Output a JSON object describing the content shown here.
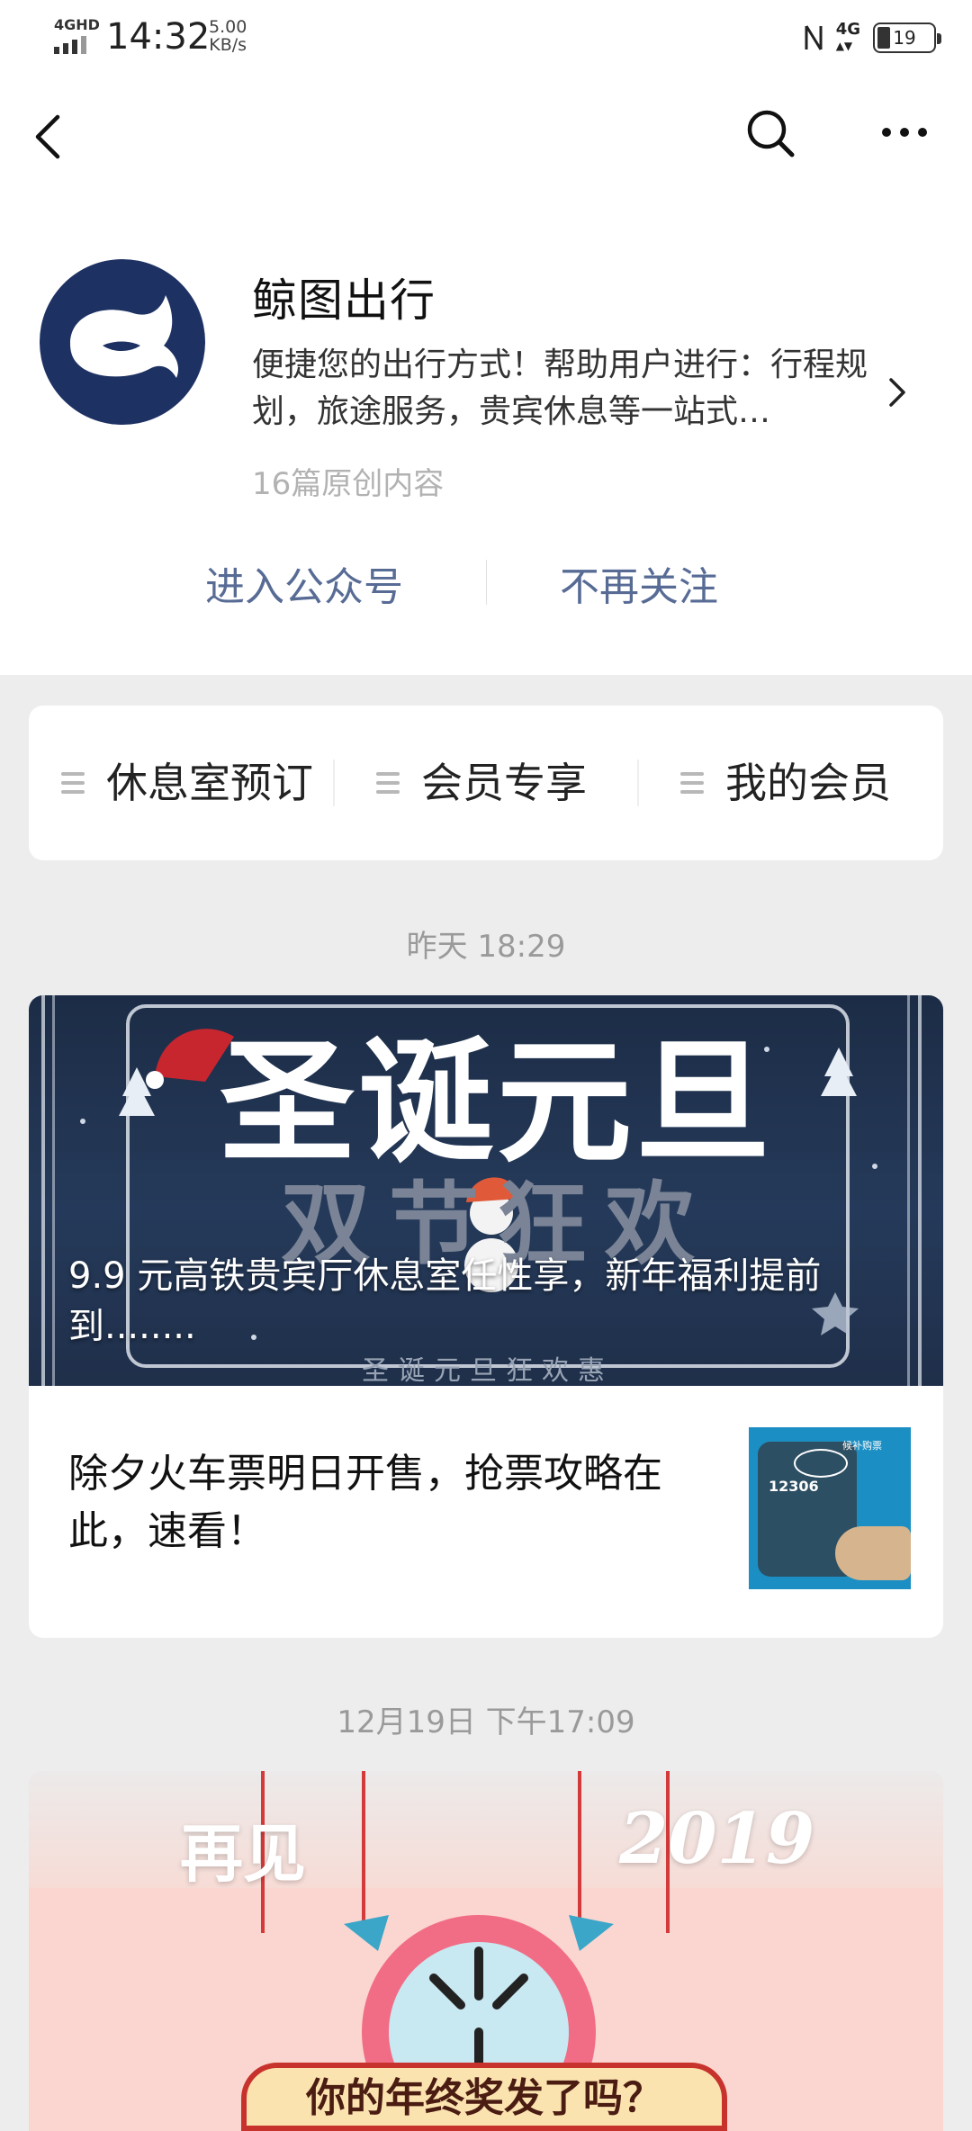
{
  "status_bar": {
    "network": "4GHD",
    "time": "14:32",
    "speed_value": "5.00",
    "speed_unit": "KB/s",
    "right_network": "4G",
    "battery": "19"
  },
  "nav": {
    "back_icon": "chevron-left-icon",
    "search_icon": "search-icon",
    "more_icon": "more-icon"
  },
  "account": {
    "name": "鲸图出行",
    "description": "便捷您的出行方式！帮助用户进行：行程规划，旅途服务，贵宾休息等一站式…",
    "count": "16篇原创内容",
    "enter_label": "进入公众号",
    "unfollow_label": "不再关注",
    "brand_color": "#1e3163",
    "link_color": "#576b95"
  },
  "menu": {
    "items": [
      {
        "label": "休息室预订",
        "icon": "menu-icon"
      },
      {
        "label": "会员专享",
        "icon": "menu-icon"
      },
      {
        "label": "我的会员",
        "icon": "menu-icon"
      }
    ]
  },
  "feed": [
    {
      "time": "昨天 18:29",
      "cover_title": "9.9 元高铁贵宾厅休息室任性享，新年福利提前到........",
      "cover_text_main": "圣诞元旦",
      "cover_text_sub": "双节狂欢",
      "cover_text_small": "圣诞元旦狂欢惠",
      "sub_article": "除夕火车票明日开售，抢票攻略在此，速看！",
      "thumb_badge": "12306",
      "thumb_tag": "候补购票"
    },
    {
      "time": "12月19日 下午17:09",
      "cover_text_left": "再见",
      "cover_text_right": "2019",
      "cover_banner": "你的年终奖发了吗？"
    }
  ]
}
